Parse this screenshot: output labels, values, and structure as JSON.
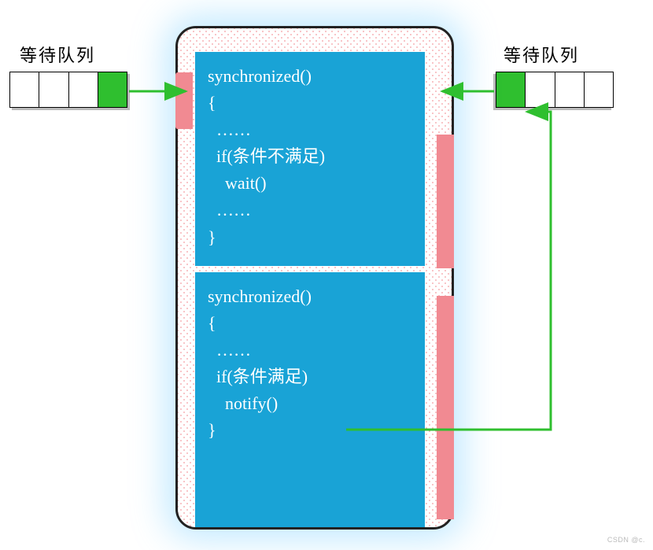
{
  "left_queue_label": "等待队列",
  "right_queue_label": "等待队列",
  "code_block_1_lines": [
    "synchronized()",
    "{",
    "  ……",
    "  if(条件不满足)",
    "    wait()",
    "  ……",
    "}"
  ],
  "code_block_2_lines": [
    "synchronized()",
    "{",
    "  ……",
    "  if(条件满足)",
    "    notify()",
    "}"
  ],
  "watermark": "CSDN @c.",
  "colors": {
    "code_block_bg": "#19a3d6",
    "code_text": "#ffffff",
    "queue_filled": "#2fbf2f",
    "monitor_accent": "#f18a92",
    "arrow": "#2fbf2f",
    "glow": "rgba(100,200,255,.40)"
  },
  "arrows": [
    {
      "from": "left-queue",
      "to": "monitor",
      "meaning": "thread waiting to enter synchronized block"
    },
    {
      "from": "monitor",
      "to": "right-queue",
      "meaning": "thread moved to wait set by wait()"
    },
    {
      "from": "notify-call",
      "to": "right-queue",
      "meaning": "notify() wakes thread in wait set"
    }
  ]
}
